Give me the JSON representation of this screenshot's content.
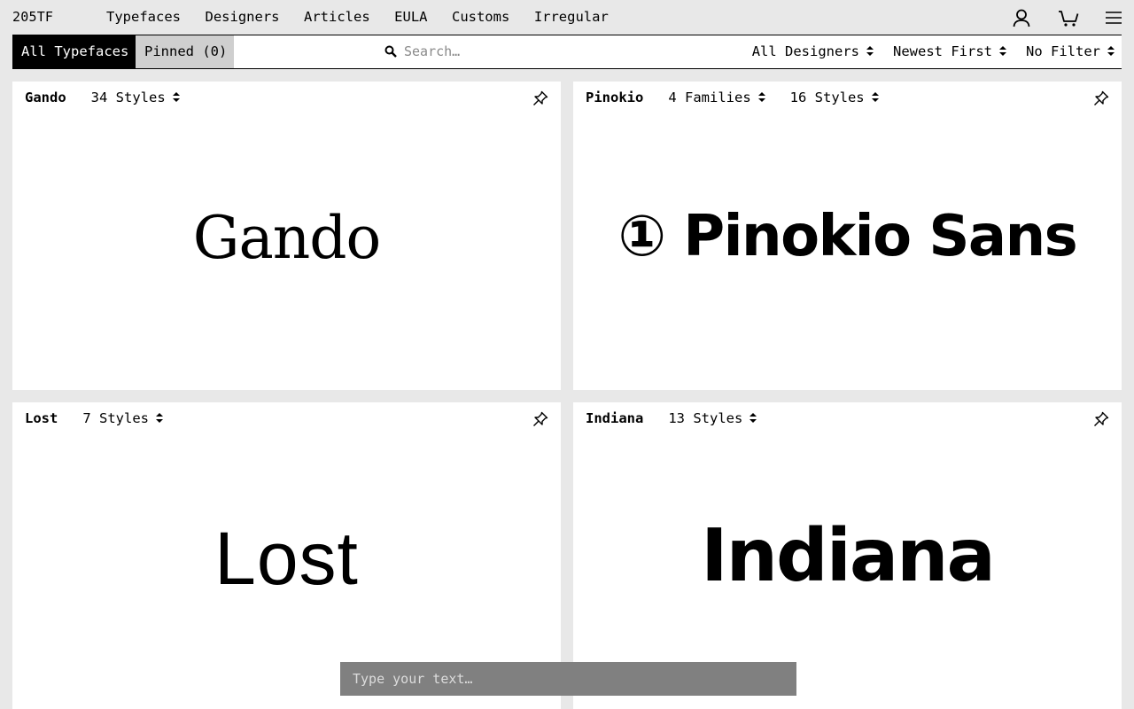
{
  "brand": "205TF",
  "nav": {
    "items": [
      "Typefaces",
      "Designers",
      "Articles",
      "EULA",
      "Customs",
      "Irregular"
    ]
  },
  "icons": {
    "account": "account-icon",
    "cart": "cart-icon",
    "menu": "hamburger-menu-icon",
    "search": "search-icon",
    "pin": "pin-icon",
    "sort": "updown-arrows-icon"
  },
  "filterbar": {
    "tab_all": "All Typefaces",
    "tab_pinned": "Pinned (0)",
    "search_placeholder": "Search…",
    "designers": "All Designers",
    "sort": "Newest First",
    "filter": "No Filter"
  },
  "cards": [
    {
      "name": "Gando",
      "meta": [
        "34 Styles"
      ],
      "specimen": "Gando"
    },
    {
      "name": "Pinokio",
      "meta": [
        "4 Families",
        "16 Styles"
      ],
      "specimen": "① Pinokio Sans"
    },
    {
      "name": "Lost",
      "meta": [
        "7 Styles"
      ],
      "specimen": "Lost"
    },
    {
      "name": "Indiana",
      "meta": [
        "13 Styles"
      ],
      "specimen": "Indiana"
    }
  ],
  "typebox": {
    "placeholder": "Type your text…"
  },
  "colors": {
    "background": "#e8e8e8",
    "card": "#ffffff",
    "active_tab": "#000000",
    "pinned_tab": "#cfcfcf",
    "typebox": "#808080"
  }
}
